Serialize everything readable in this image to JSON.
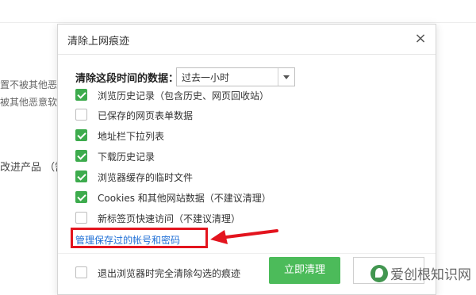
{
  "background": {
    "line1": "置不被其他恶",
    "line2": "被其他恶意软",
    "line3": "改进产品 （需"
  },
  "dialog": {
    "title": "清除上网痕迹",
    "close_icon": "close-icon",
    "range_label": "清除这段时间的数据：",
    "range_value": "过去一小时",
    "options": [
      {
        "label": "浏览历史记录（包含历史、网页回收站）",
        "checked": true
      },
      {
        "label": "已保存的网页表单数据",
        "checked": false
      },
      {
        "label": "地址栏下拉列表",
        "checked": true
      },
      {
        "label": "下载历史记录",
        "checked": true
      },
      {
        "label": "浏览器缓存的临时文件",
        "checked": true
      },
      {
        "label": "Cookies 和其他网站数据（不建议清理）",
        "checked": true
      },
      {
        "label": "新标签页快速访问（不建议清理）",
        "checked": false
      }
    ],
    "manage_link": "管理保存过的帐号和密码",
    "exit_option": {
      "label": "退出浏览器时完全清除勾选的痕迹",
      "checked": false
    },
    "clear_button": "立即清理",
    "cancel_button": ""
  },
  "annotation": {
    "highlight_color": "#e3141e"
  },
  "colors": {
    "accent_green": "#4cbb5a",
    "check_green": "#3dab4d",
    "link_blue": "#1f6fd6"
  },
  "watermark": {
    "text": "爱创根知识网"
  }
}
